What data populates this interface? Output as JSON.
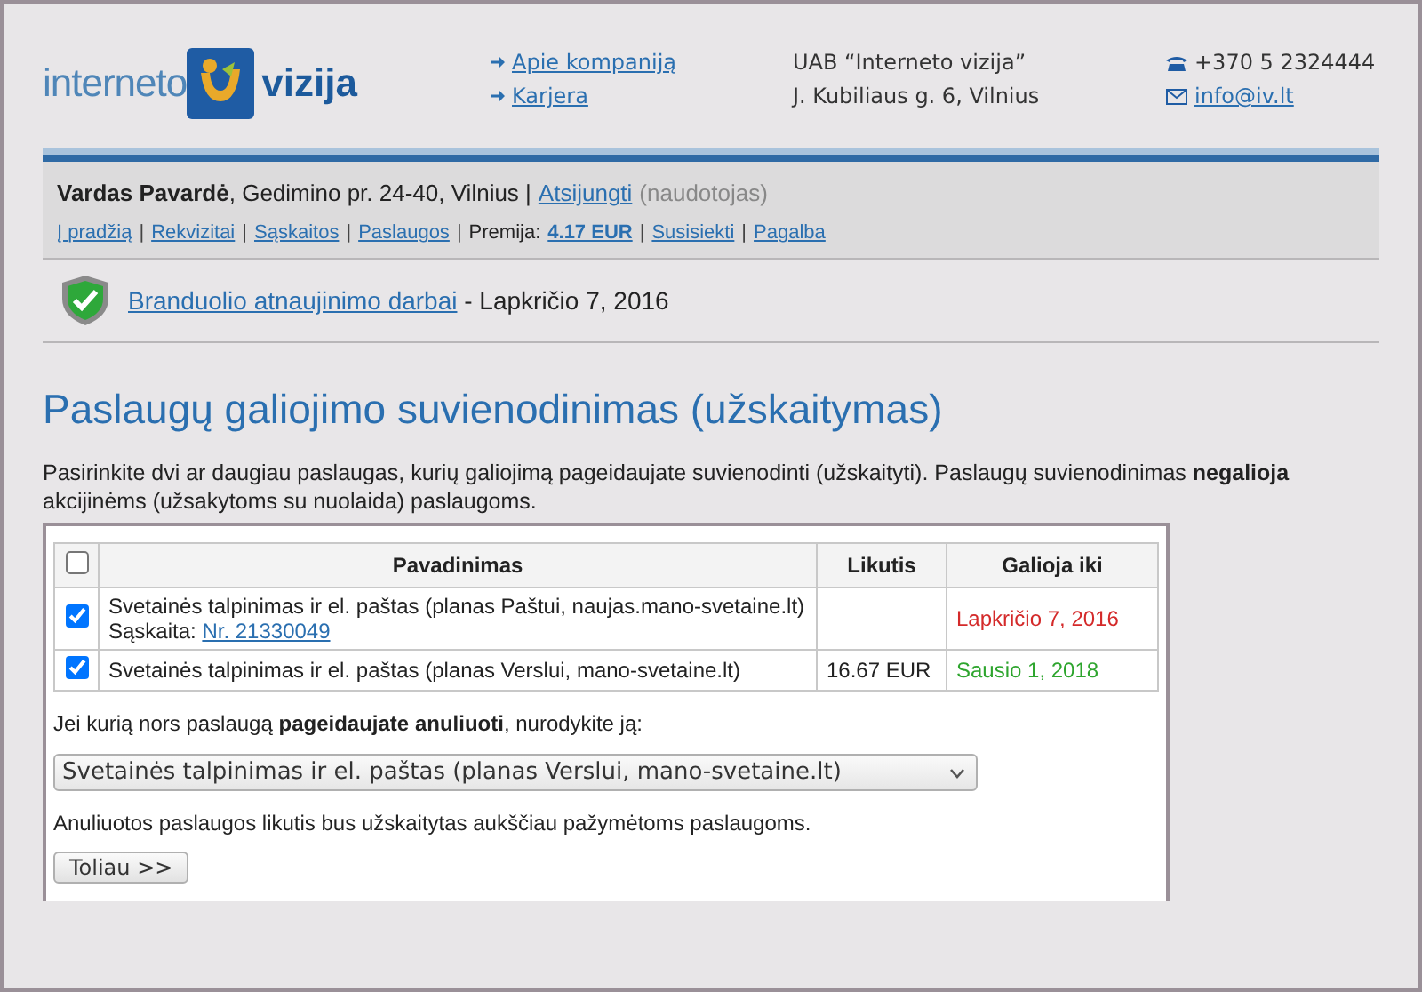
{
  "header": {
    "logo": {
      "left": "interneto",
      "right": "vizija"
    },
    "links": [
      "Apie kompaniją",
      "Karjera"
    ],
    "company": [
      "UAB “Interneto vizija”",
      "J. Kubiliaus g. 6, Vilnius"
    ],
    "phone": "+370 5 2324444",
    "email": "info@iv.lt"
  },
  "user": {
    "name": "Vardas Pavardė",
    "details": ", Gedimino pr. 24-40, Vilnius |",
    "logout": "Atsijungti",
    "role": "(naudotojas)"
  },
  "nav": {
    "separator": "|",
    "items": [
      {
        "label": "Į pradžią",
        "kind": "link"
      },
      {
        "label": "Rekvizitai",
        "kind": "link"
      },
      {
        "label": "Sąskaitos",
        "kind": "link"
      },
      {
        "label": "Paslaugos",
        "kind": "link"
      },
      {
        "label": "Premija:",
        "kind": "label",
        "value": "4.17 EUR"
      },
      {
        "label": "Susisiekti",
        "kind": "link"
      },
      {
        "label": "Pagalba",
        "kind": "link"
      }
    ]
  },
  "notice": {
    "link": "Branduolio atnaujinimo darbai",
    "text": "- Lapkričio 7, 2016"
  },
  "title": "Paslaugų galiojimo suvienodinimas (užskaitymas)",
  "intro": "Pasirinkite dvi ar daugiau paslaugas, kurių galiojimą pageidaujate suvienodinti (užskaityti). Paslaugų suvienodinimas **negalioja** akcijinėms (užsakytoms su nuolaida) paslaugoms.",
  "table": {
    "select_all": {
      "checked": false
    },
    "columns": [
      "Pavadinimas",
      "Likutis",
      "Galioja iki"
    ],
    "rows": [
      {
        "checked": true,
        "name": "Svetainės talpinimas ir el. paštas (planas Paštui, naujas.mano-svetaine.lt)",
        "invoice_label": "Sąskaita:",
        "invoice": "Nr. 21330049",
        "valid_until": "Lapkričio 7, 2016",
        "color": "#d42a2a"
      },
      {
        "checked": true,
        "name": "Svetainės talpinimas ir el. paštas (planas Verslui, mano-svetaine.lt)",
        "balance": "16.67 EUR",
        "valid_until": "Sausio 1, 2018",
        "color": "#2ea52e"
      }
    ]
  },
  "cancel_prompt": "Jei kurią nors paslaugą **pageidaujate anuliuoti**, nurodykite ją:",
  "cancel_select": {
    "value": "Svetainės talpinimas ir el. paštas (planas Verslui, mano-svetaine.lt)"
  },
  "note": "Anuliuotos paslaugos likutis bus užskaitytas aukščiau pažymėtoms paslaugoms.",
  "submit": "Toliau >>"
}
